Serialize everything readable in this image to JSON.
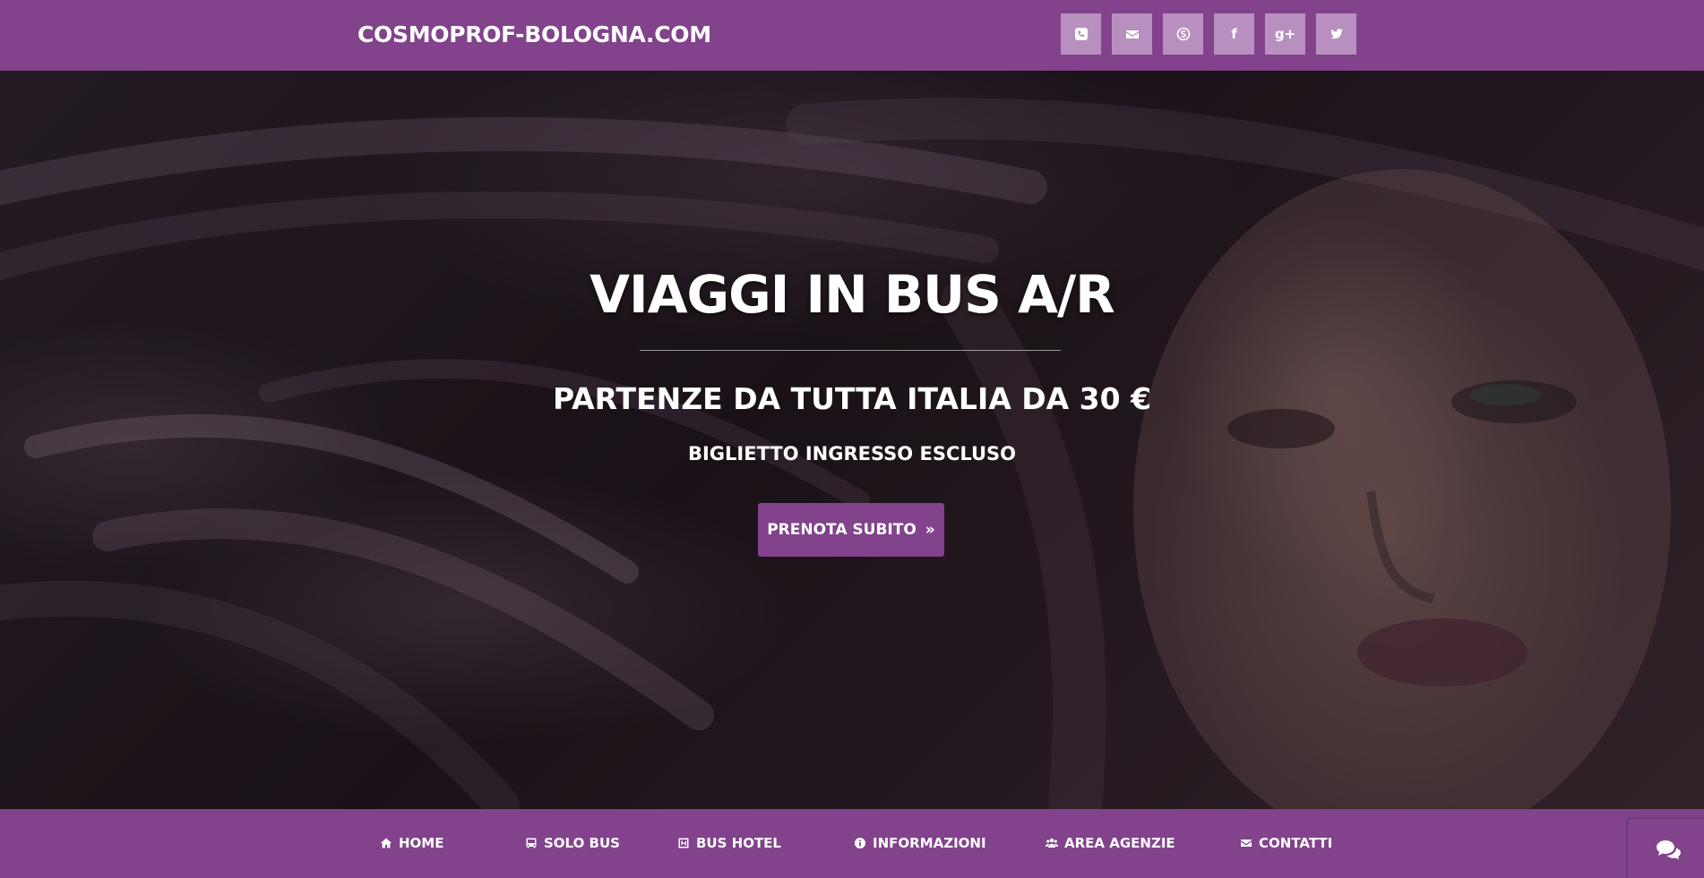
{
  "header": {
    "brand": "COSMOPROF-BOLOGNA.COM",
    "social": [
      {
        "icon": "phone-icon"
      },
      {
        "icon": "envelope-icon"
      },
      {
        "icon": "skype-icon"
      },
      {
        "icon": "facebook-icon",
        "glyph": "f"
      },
      {
        "icon": "google-plus-icon",
        "glyph": "g+"
      },
      {
        "icon": "twitter-icon"
      }
    ]
  },
  "hero": {
    "title": "VIAGGI IN BUS A/R",
    "subtitle": "PARTENZE DA TUTTA ITALIA DA 30 €",
    "note": "BIGLIETTO INGRESSO ESCLUSO",
    "cta_label": "PRENOTA SUBITO",
    "cta_icon": "double-chevron-right-icon"
  },
  "nav": {
    "items": [
      {
        "label": "HOME",
        "icon": "home-icon"
      },
      {
        "label": "SOLO BUS",
        "icon": "bus-icon"
      },
      {
        "label": "BUS HOTEL",
        "icon": "hotel-icon"
      },
      {
        "label": "INFORMAZIONI",
        "icon": "info-icon"
      },
      {
        "label": "AREA AGENZIE",
        "icon": "users-icon"
      },
      {
        "label": "CONTATTI",
        "icon": "envelope-icon"
      }
    ]
  },
  "chat": {
    "icon": "chat-bubbles-icon"
  },
  "colors": {
    "brand_purple": "#82428c",
    "social_button": "#b890bf",
    "text": "#ffffff"
  }
}
